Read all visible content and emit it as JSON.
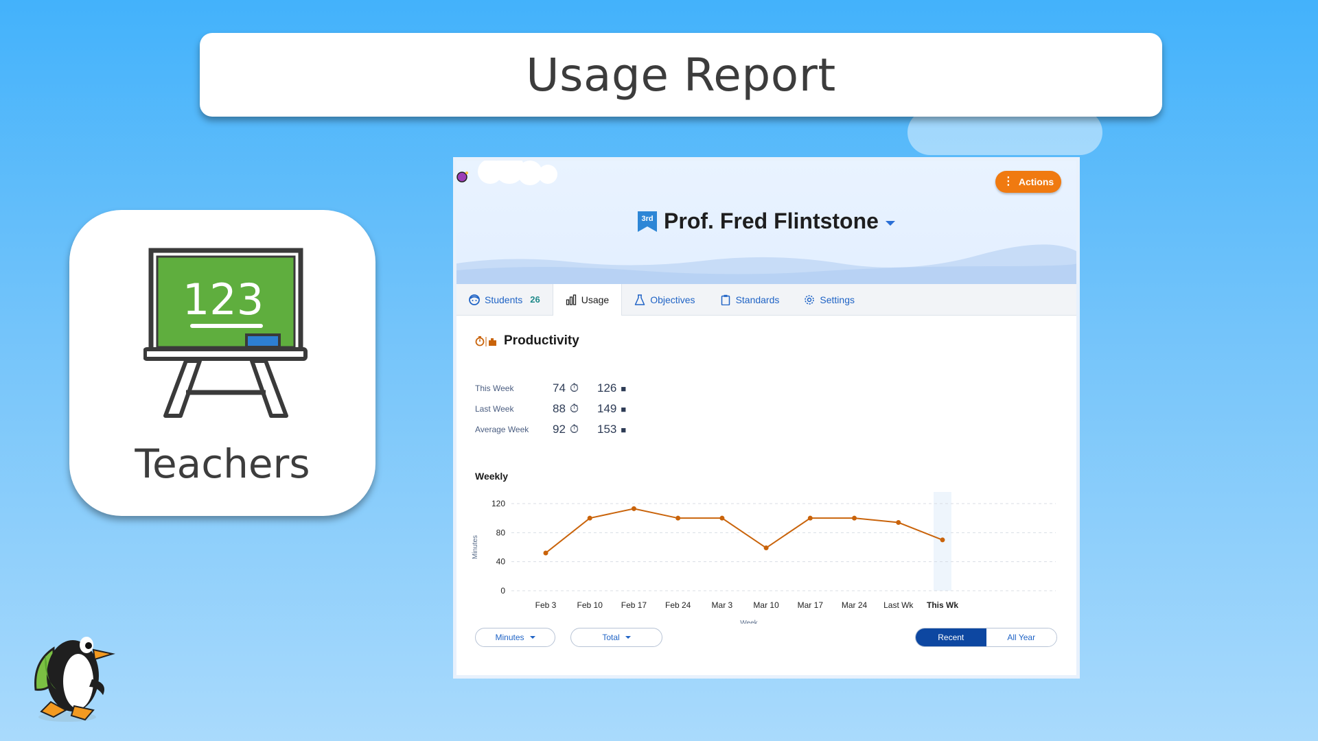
{
  "slide": {
    "title": "Usage Report",
    "card_label": "Teachers",
    "board_text": "123"
  },
  "app": {
    "actions_label": "Actions",
    "grade_badge": "3rd",
    "teacher_name": "Prof. Fred Flintstone",
    "tabs": [
      {
        "label": "Students",
        "count": "26",
        "icon": "student-face-icon"
      },
      {
        "label": "Usage",
        "icon": "bar-chart-icon",
        "active": true
      },
      {
        "label": "Objectives",
        "icon": "flask-icon"
      },
      {
        "label": "Standards",
        "icon": "clipboard-icon"
      },
      {
        "label": "Settings",
        "icon": "gear-icon"
      }
    ],
    "productivity": {
      "title": "Productivity",
      "rows": [
        {
          "label": "This Week",
          "minutes": "74",
          "puzzles": "126"
        },
        {
          "label": "Last Week",
          "minutes": "88",
          "puzzles": "149"
        },
        {
          "label": "Average Week",
          "minutes": "92",
          "puzzles": "153"
        }
      ]
    },
    "weekly_title": "Weekly",
    "controls": {
      "metric": "Minutes",
      "aggregate": "Total",
      "range_on": "Recent",
      "range_off": "All Year"
    },
    "colors": {
      "accent": "#f07a10",
      "line": "#c9630a",
      "nav": "#1f63c5",
      "segment": "#0d47a1"
    }
  },
  "chart_data": {
    "type": "line",
    "title": "Weekly",
    "xlabel": "Week",
    "ylabel": "Minutes",
    "ylim": [
      0,
      120
    ],
    "yticks": [
      0,
      40,
      80,
      120
    ],
    "categories": [
      "Feb 3",
      "Feb 10",
      "Feb 17",
      "Feb 24",
      "Mar 3",
      "Mar 10",
      "Mar 17",
      "Mar 24",
      "Last Wk",
      "This Wk"
    ],
    "values": [
      52,
      100,
      113,
      100,
      100,
      59,
      100,
      100,
      94,
      70
    ],
    "highlight": "This Wk",
    "grid": true
  }
}
